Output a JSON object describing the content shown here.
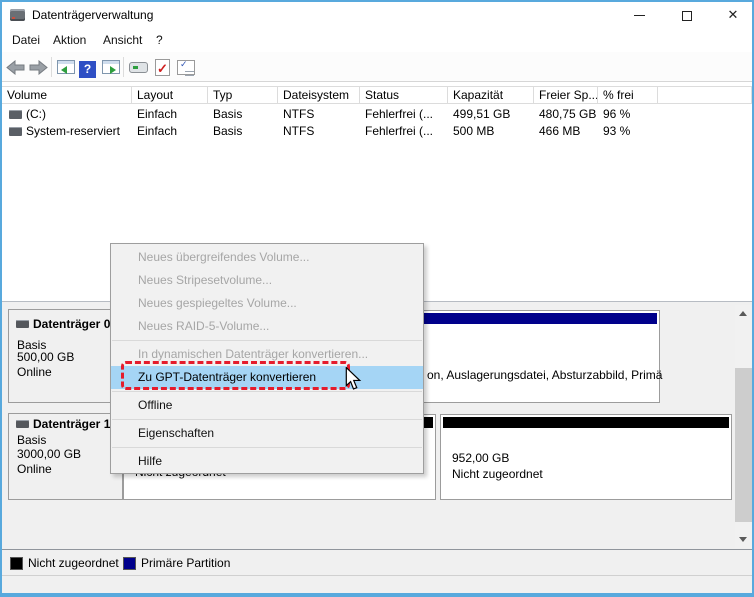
{
  "window": {
    "title": "Datenträgerverwaltung",
    "close_glyph": "✕"
  },
  "menubar": {
    "items": [
      "Datei",
      "Aktion",
      "Ansicht",
      "?"
    ]
  },
  "toolbar": {
    "icons": [
      "back",
      "forward",
      "show-console-tree",
      "help",
      "show-action-pane",
      "popup-window",
      "action-check",
      "checklist"
    ],
    "help_glyph": "?",
    "check_glyph": "✓",
    "checklist_glyph": "✓"
  },
  "volume_table": {
    "columns": [
      "Volume",
      "Layout",
      "Typ",
      "Dateisystem",
      "Status",
      "Kapazität",
      "Freier Sp...",
      "% frei"
    ],
    "rows": [
      [
        "(C:)",
        "Einfach",
        "Basis",
        "NTFS",
        "Fehlerfrei (...",
        "499,51 GB",
        "480,75 GB",
        "96 %"
      ],
      [
        "System-reserviert",
        "Einfach",
        "Basis",
        "NTFS",
        "Fehlerfrei (...",
        "500 MB",
        "466 MB",
        "93 %"
      ]
    ]
  },
  "disks": [
    {
      "name": "Datenträger 0",
      "type": "Basis",
      "size": "500,00 GB",
      "status": "Online",
      "partition": {
        "visible_text": "on, Auslagerungsdatei, Absturzabbild, Primä",
        "color": "#00008b"
      }
    },
    {
      "name": "Datenträger 1",
      "type": "Basis",
      "size": "3000,00 GB",
      "status": "Online",
      "regions": [
        {
          "label": "Nicht zugeordnet",
          "color": "#000000"
        },
        {
          "size": "952,00 GB",
          "label": "Nicht zugeordnet",
          "color": "#000000"
        }
      ]
    }
  ],
  "context_menu": {
    "items": [
      {
        "label": "Neues übergreifendes Volume...",
        "state": "disabled"
      },
      {
        "label": "Neues Stripesetvolume...",
        "state": "disabled"
      },
      {
        "label": "Neues gespiegeltes Volume...",
        "state": "disabled"
      },
      {
        "label": "Neues RAID-5-Volume...",
        "state": "disabled"
      },
      {
        "separator": true
      },
      {
        "label": "In dynamischen Datenträger konvertieren...",
        "state": "disabled"
      },
      {
        "label": "Zu GPT-Datenträger konvertieren",
        "state": "highlighted"
      },
      {
        "separator": true
      },
      {
        "label": "Offline",
        "state": "enabled"
      },
      {
        "separator": true
      },
      {
        "label": "Eigenschaften",
        "state": "enabled"
      },
      {
        "separator": true
      },
      {
        "label": "Hilfe",
        "state": "enabled"
      }
    ]
  },
  "legend": {
    "items": [
      {
        "label": "Nicht zugeordnet",
        "color": "#000000"
      },
      {
        "label": "Primäre Partition",
        "color": "#00008b"
      }
    ]
  },
  "colors": {
    "window_border": "#58a9dd",
    "menu_highlight": "#a5d5f5",
    "annotation_red": "#e51c2c",
    "primary_partition": "#00008b",
    "unallocated": "#000000"
  }
}
